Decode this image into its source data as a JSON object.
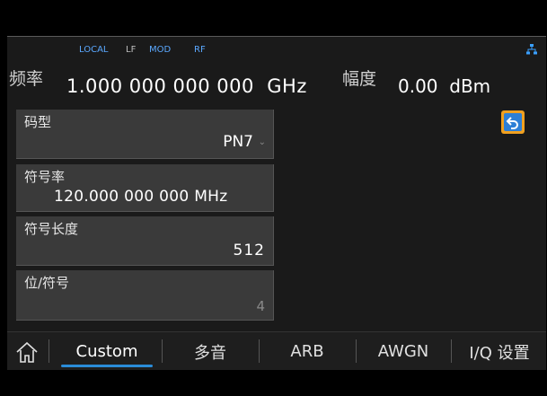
{
  "status": {
    "local": "LOCAL",
    "lf": "LF",
    "mod": "MOD",
    "rf": "RF",
    "network_icon": "network-icon"
  },
  "frequency": {
    "label": "频率",
    "value": "1.000 000 000 000",
    "unit": "GHz"
  },
  "amplitude": {
    "label": "幅度",
    "value": "0.00",
    "unit": "dBm"
  },
  "panels": {
    "pattern": {
      "label": "码型",
      "value": "PN7"
    },
    "symbol_rate": {
      "label": "符号率",
      "value": "120.000 000 000 MHz"
    },
    "symbol_length": {
      "label": "符号长度",
      "value": "512"
    },
    "bits_per_symbol": {
      "label": "位/符号",
      "value": "4"
    }
  },
  "tabs": [
    "Custom",
    "多音",
    "ARB",
    "AWGN",
    "I/Q 设置"
  ],
  "active_tab": "Custom",
  "colors": {
    "accent": "#2a8cd8",
    "back_button_border": "#f0a020",
    "back_button_fill": "#2d7fd6"
  }
}
